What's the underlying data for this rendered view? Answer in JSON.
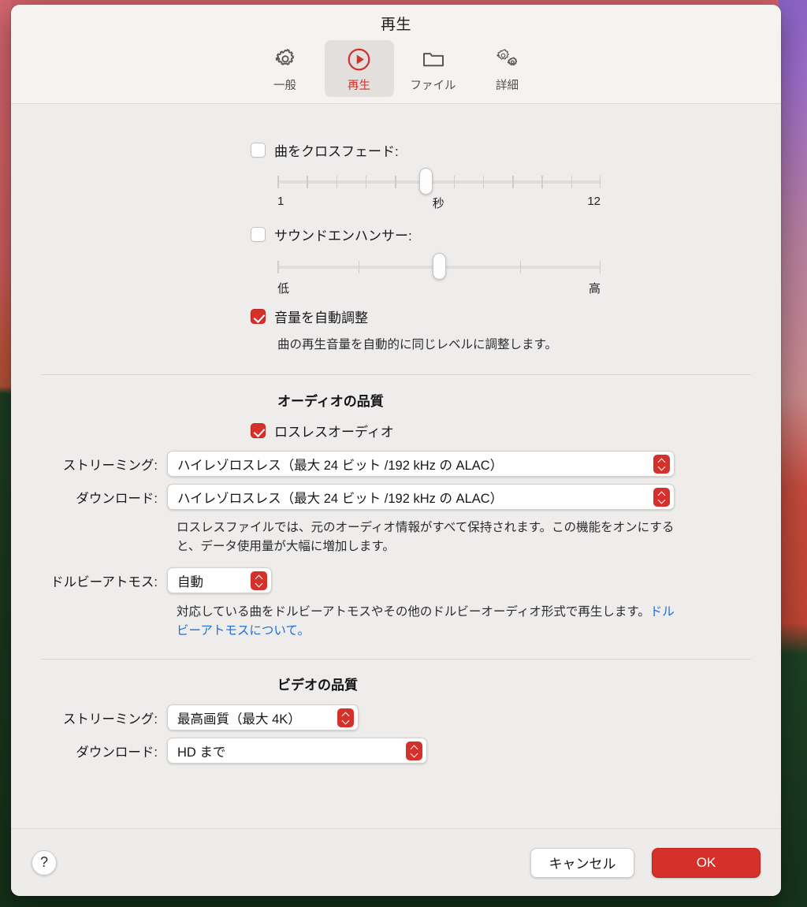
{
  "window": {
    "title": "再生"
  },
  "toolbar": {
    "tabs": [
      {
        "label": "一般",
        "icon": "gear-icon",
        "selected": false
      },
      {
        "label": "再生",
        "icon": "play-circle-icon",
        "selected": true
      },
      {
        "label": "ファイル",
        "icon": "folder-icon",
        "selected": false
      },
      {
        "label": "詳細",
        "icon": "double-gear-icon",
        "selected": false
      }
    ]
  },
  "playback": {
    "crossfade": {
      "label": "曲をクロスフェード:",
      "checked": false,
      "min_label": "1",
      "unit_label": "秒",
      "max_label": "12",
      "value_percent": 46,
      "tick_count": 12
    },
    "sound_enhancer": {
      "label": "サウンドエンハンサー:",
      "checked": false,
      "min_label": "低",
      "max_label": "高",
      "value_percent": 50,
      "tick_count": 3
    },
    "sound_check": {
      "label": "音量を自動調整",
      "checked": true,
      "hint": "曲の再生音量を自動的に同じレベルに調整します。"
    }
  },
  "audio_quality": {
    "heading": "オーディオの品質",
    "lossless": {
      "label": "ロスレスオーディオ",
      "checked": true
    },
    "streaming": {
      "label": "ストリーミング:",
      "value": "ハイレゾロスレス（最大 24 ビット /192 kHz の ALAC）"
    },
    "download": {
      "label": "ダウンロード:",
      "value": "ハイレゾロスレス（最大 24 ビット /192 kHz の ALAC）"
    },
    "hint": "ロスレスファイルでは、元のオーディオ情報がすべて保持されます。この機能をオンにすると、データ使用量が大幅に増加します。",
    "dolby_atmos": {
      "label": "ドルビーアトモス:",
      "value": "自動",
      "hint_before_link": "対応している曲をドルビーアトモスやその他のドルビーオーディオ形式で再生します。",
      "link_text": "ドルビーアトモスについて。"
    }
  },
  "video_quality": {
    "heading": "ビデオの品質",
    "streaming": {
      "label": "ストリーミング:",
      "value": "最高画質（最大 4K）"
    },
    "download": {
      "label": "ダウンロード:",
      "value": "HD まで"
    }
  },
  "footer": {
    "help_label": "?",
    "cancel_label": "キャンセル",
    "ok_label": "OK"
  },
  "colors": {
    "accent_red": "#d6302b",
    "link_blue": "#1f6fd6",
    "window_bg": "#efedeb",
    "toolbar_bg": "#f5f2f0"
  }
}
